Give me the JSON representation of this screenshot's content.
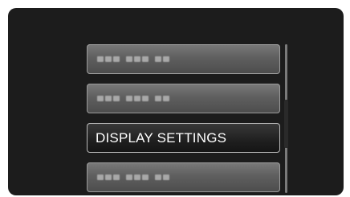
{
  "menu": {
    "items": [
      {
        "label": "",
        "selected": false,
        "placeholder": true
      },
      {
        "label": "",
        "selected": false,
        "placeholder": true
      },
      {
        "label": "DISPLAY SETTINGS",
        "selected": true,
        "placeholder": false
      },
      {
        "label": "",
        "selected": false,
        "placeholder": true
      }
    ]
  },
  "scrollbar": {
    "position_fraction": 0.55
  },
  "colors": {
    "background": "#1c1c1c",
    "item": "#5f5f5f",
    "item_selected": "#1f1f1f",
    "text": "#ffffff"
  }
}
